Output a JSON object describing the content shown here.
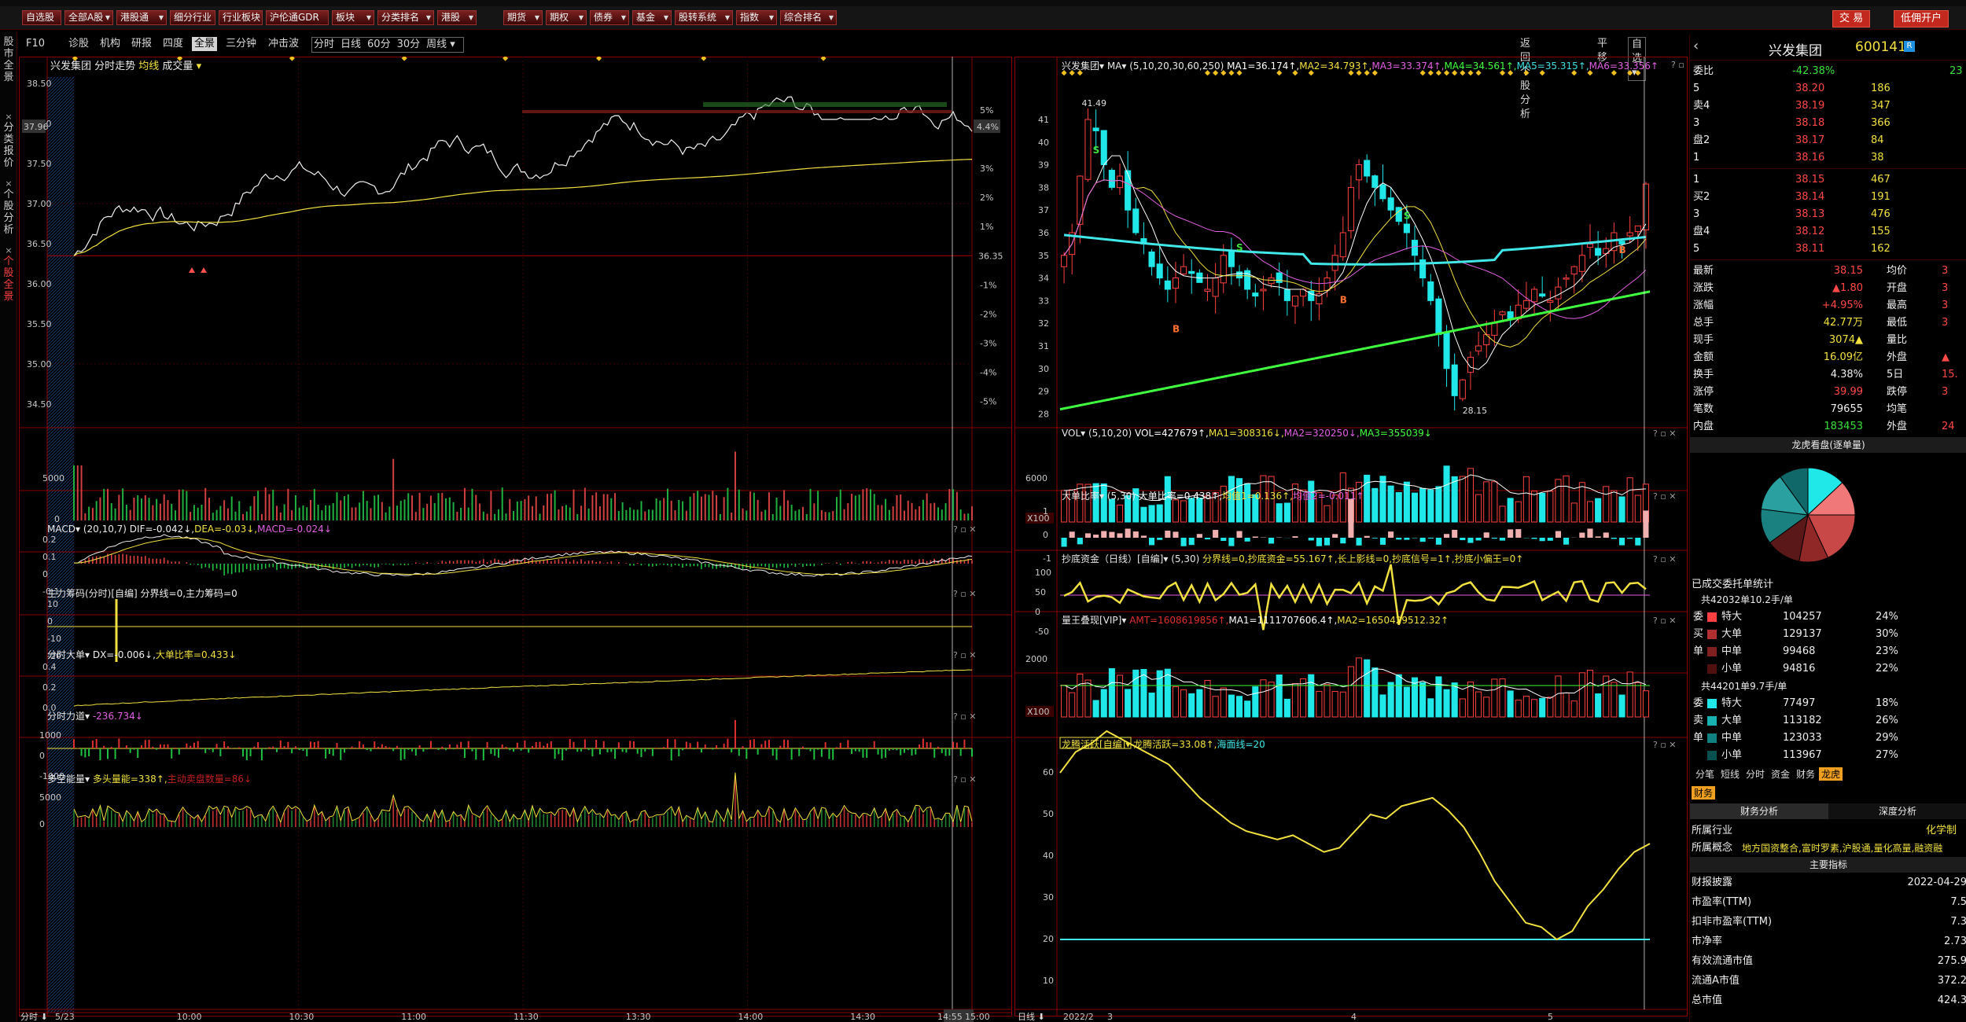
{
  "menubar": {
    "items": [
      {
        "label": "自选股",
        "dd": false
      },
      {
        "label": "全部A股",
        "dd": true
      },
      {
        "label": "港股通",
        "dd": true
      },
      {
        "label": "细分行业",
        "dd": false
      },
      {
        "label": "行业板块",
        "dd": false
      },
      {
        "label": "沪伦通GDR",
        "dd": false
      },
      {
        "label": "板块",
        "dd": true
      },
      {
        "label": "分类排名",
        "dd": true
      },
      {
        "label": "港股",
        "dd": true
      },
      {
        "label": "期货",
        "dd": true
      },
      {
        "label": "期权",
        "dd": true
      },
      {
        "label": "债券",
        "dd": true
      },
      {
        "label": "基金",
        "dd": true
      },
      {
        "label": "股转系统",
        "dd": true
      },
      {
        "label": "指数",
        "dd": true
      },
      {
        "label": "综合排名",
        "dd": true
      }
    ],
    "trade": "交 易",
    "open_account": "低佣开户"
  },
  "lefttabs": [
    {
      "label": "股\n市\n全\n景",
      "active": false
    },
    {
      "label": "分\n类\n报\n价",
      "active": false
    },
    {
      "label": "个\n股\n分\n析",
      "active": false
    },
    {
      "label": "个\n股\n全\n景",
      "active": true
    }
  ],
  "tabbar": {
    "left": [
      "F10",
      "诊股",
      "机构",
      "研报",
      "四度",
      "全景",
      "三分钟",
      "冲击波"
    ],
    "active_left": "全景",
    "mid": [
      "分时",
      "日线",
      "60分",
      "30分",
      "周线"
    ],
    "right": [
      "返回个股分析",
      "平移",
      "自选"
    ]
  },
  "intraday": {
    "header": {
      "name": "兴发集团",
      "mode": "分时走势",
      "avg": "均线",
      "vol": "成交量"
    },
    "price_ticks": [
      "38.50",
      "38.00",
      "37.50",
      "37.00",
      "36.50",
      "36.00",
      "35.50",
      "35.00",
      "34.50"
    ],
    "pct_ticks": [
      "5%",
      "4%",
      "3%",
      "2%",
      "1%",
      "-1%",
      "-2%",
      "-3%",
      "-4%",
      "-5%"
    ],
    "prev_close": "36.35",
    "cur_price": "37.96",
    "cur_pct": "4.4%",
    "vol_ticks": [
      "5000",
      "0"
    ],
    "macd": {
      "label": "MACD",
      "params": "(20,10,7)",
      "dif": "DIF=-0.042",
      "dea": "DEA=-0.03",
      "macd": "MACD=-0.024",
      "ticks": [
        "0.2",
        "0.1",
        "0",
        "-0.1"
      ]
    },
    "zl": {
      "label": "主力筹码(分时)[自编]",
      "text": "分界线=0,主力筹码=0",
      "ticks": [
        "10",
        "0",
        "-10",
        "-20"
      ]
    },
    "dd": {
      "label": "分时大单",
      "dx": "DX=-0.006",
      "ddbl": "大单比率=0.433",
      "ticks": [
        "0.4",
        "0.2",
        "0.0"
      ]
    },
    "fl": {
      "label": "分时力道",
      "val": "-236.734",
      "ticks": [
        "1000",
        "0",
        "-1000"
      ]
    },
    "dk": {
      "label": "多空能量",
      "dt": "多头量能=338",
      "kt": "主动卖盘数量=86",
      "ticks": [
        "5000",
        "0"
      ]
    },
    "time_labels": [
      "5/23",
      "10:00",
      "10:30",
      "11:00",
      "11:30",
      "13:30",
      "14:00",
      "14:30",
      "14:55",
      "15:00"
    ],
    "period_btn": "分时"
  },
  "kline": {
    "header": {
      "name": "兴发集团",
      "ma": "MA",
      "params": "(5,10,20,30,60,250)",
      "ma1": "MA1=36.174",
      "ma2": "MA2=34.793",
      "ma3": "MA3=33.374",
      "ma4": "MA4=34.561",
      "ma5": "MA5=35.315",
      "ma6": "MA6=33.356"
    },
    "price_ticks": [
      "41",
      "40",
      "39",
      "38",
      "37",
      "36",
      "35",
      "34",
      "33",
      "32",
      "31",
      "30",
      "29",
      "28"
    ],
    "high_label": "41.49",
    "low_label": "28.15",
    "vol": {
      "label": "VOL",
      "params": "(5,10,20)",
      "v": "VOL=427679",
      "ma1": "MA1=308316",
      "ma2": "MA2=320250",
      "ma3": "MA3=355039",
      "tick": "6000",
      "unit": "X100"
    },
    "ddbl": {
      "label": "大单比率",
      "params": "(5,30)",
      "v": "大单比率=0.438",
      "j1": "均值1=0.136",
      "j2": "均值2=-0.011",
      "ticks": [
        "1",
        "0",
        "-1"
      ]
    },
    "cd": {
      "label": "抄底资金（日线）[自编]",
      "params": "(5,30)",
      "txt": "分界线=0,抄底资金=55.167",
      "s2": "长上影线=0,抄底信号=1",
      "s3": "抄底小偏王=0",
      "ticks": [
        "100",
        "50",
        "0",
        "-50"
      ]
    },
    "lw": {
      "label": "量王叠现[VIP]",
      "amt": "AMT=1608619856",
      "ma1": "MA1=1111707606.4",
      "ma2": "MA2=1650429512.32",
      "tick": "2000",
      "unit": "X100"
    },
    "lt": {
      "label": "龙腾活跃[自编]",
      "v": "龙腾活跃=33.08",
      "h": "海面线=20",
      "ticks": [
        "60",
        "50",
        "40",
        "30",
        "20",
        "10"
      ]
    },
    "date_labels": [
      "2022/2",
      "3",
      "4",
      "5"
    ],
    "period_btn": "日线"
  },
  "quote": {
    "name": "兴发集团",
    "code": "600141",
    "wb_label": "委比",
    "wb_val": "-42.38%",
    "wb_diff": "23",
    "asks": [
      {
        "l": "5",
        "p": "38.20",
        "v": "186"
      },
      {
        "l": "卖4",
        "p": "38.19",
        "v": "347"
      },
      {
        "l": "3",
        "p": "38.18",
        "v": "366"
      },
      {
        "l": "盘2",
        "p": "38.17",
        "v": "84"
      },
      {
        "l": "1",
        "p": "38.16",
        "v": "38"
      }
    ],
    "bids": [
      {
        "l": "1",
        "p": "38.15",
        "v": "467"
      },
      {
        "l": "买2",
        "p": "38.14",
        "v": "191"
      },
      {
        "l": "3",
        "p": "38.13",
        "v": "476"
      },
      {
        "l": "盘4",
        "p": "38.12",
        "v": "155"
      },
      {
        "l": "5",
        "p": "38.11",
        "v": "162"
      }
    ],
    "stats": [
      {
        "k1": "最新",
        "v1": "38.15",
        "k2": "均价",
        "v2": "3"
      },
      {
        "k1": "涨跌",
        "v1": "▲1.80",
        "k2": "开盘",
        "v2": "3"
      },
      {
        "k1": "涨幅",
        "v1": "+4.95%",
        "k2": "最高",
        "v2": "3"
      },
      {
        "k1": "总手",
        "v1": "42.77万",
        "k2": "最低",
        "v2": "3"
      },
      {
        "k1": "现手",
        "v1": "3074▲",
        "k2": "量比",
        "v2": ""
      },
      {
        "k1": "金额",
        "v1": "16.09亿",
        "k2": "外盘",
        "v2": "▲"
      },
      {
        "k1": "换手",
        "v1": "4.38%",
        "k2": "5日",
        "v2": "15."
      },
      {
        "k1": "涨停",
        "v1": "39.99",
        "k2": "跌停",
        "v2": "3"
      },
      {
        "k1": "笔数",
        "v1": "79655",
        "k2": "均笔",
        "v2": ""
      },
      {
        "k1": "内盘",
        "v1": "183453",
        "k2": "外盘",
        "v2": "24"
      }
    ],
    "lhk_title": "龙虎看盘(逐单量)",
    "pie_colors": [
      "#20e8e8",
      "#f07878",
      "#c84848",
      "#902828",
      "#5a1818",
      "#1a8080",
      "#2aa0a0",
      "#106868"
    ],
    "pie_shares": [
      0.13,
      0.12,
      0.18,
      0.1,
      0.12,
      0.12,
      0.13,
      0.1
    ],
    "wt_title": "已成交委托单统计",
    "buy_total": "共42032单10.2手/单",
    "buy_rows": [
      {
        "side": "委",
        "k": "特大",
        "v": "104257",
        "p": "24%"
      },
      {
        "side": "买",
        "k": "大单",
        "v": "129137",
        "p": "30%"
      },
      {
        "side": "单",
        "k": "中单",
        "v": "99468",
        "p": "23%"
      },
      {
        "side": "",
        "k": "小单",
        "v": "94816",
        "p": "22%"
      }
    ],
    "sell_total": "共44201单9.7手/单",
    "sell_rows": [
      {
        "side": "委",
        "k": "特大",
        "v": "77497",
        "p": "18%"
      },
      {
        "side": "卖",
        "k": "大单",
        "v": "113182",
        "p": "26%"
      },
      {
        "side": "单",
        "k": "中单",
        "v": "123033",
        "p": "29%"
      },
      {
        "side": "",
        "k": "小单",
        "v": "113967",
        "p": "27%"
      }
    ],
    "bottom_tabs": [
      "分笔",
      "短线",
      "分时",
      "资金",
      "财务",
      "龙虎"
    ],
    "fin_tab": "财务",
    "fin_sub": [
      "财务分析",
      "深度分析"
    ],
    "industry_k": "所属行业",
    "industry_v": "化学制",
    "concept_k": "所属概念",
    "concept_v": "地方国资整合,富时罗素,沪股通,量化高量,融资融",
    "main_idx": "主要指标",
    "fin_rows": [
      {
        "k": "财报披露",
        "v": "2022-04-29"
      },
      {
        "k": "市盈率(TTM)",
        "v": "7.5"
      },
      {
        "k": "扣非市盈率(TTM)",
        "v": "7.3"
      },
      {
        "k": "市净率",
        "v": "2.73"
      },
      {
        "k": "有效流通市值",
        "v": "275.9"
      },
      {
        "k": "流通A市值",
        "v": "372.2"
      },
      {
        "k": "总市值",
        "v": "424.3"
      }
    ]
  }
}
